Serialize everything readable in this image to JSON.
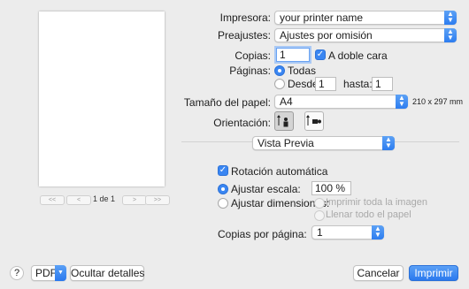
{
  "preview": {
    "page_counter": "1 de 1",
    "nav": {
      "first": "<<",
      "prev": "<",
      "next": ">",
      "last": ">>"
    }
  },
  "printer": {
    "label": "Impresora:",
    "value": "your printer name"
  },
  "presets": {
    "label": "Preajustes:",
    "value": "Ajustes por omisión"
  },
  "copies": {
    "label": "Copias:",
    "value": "1",
    "duplex_label": "A doble cara",
    "duplex_checked": true
  },
  "pages": {
    "label": "Páginas:",
    "all_label": "Todas",
    "from_label": "Desde:",
    "from_value": "1",
    "to_label": "hasta:",
    "to_value": "1",
    "selected": "Todas"
  },
  "paper": {
    "label": "Tamaño del papel:",
    "value": "A4",
    "dimensions": "210 x 297 mm"
  },
  "orientation": {
    "label": "Orientación:",
    "selected": "portrait"
  },
  "section_menu": {
    "value": "Vista Previa"
  },
  "auto_rotate": {
    "label": "Rotación automática",
    "checked": true
  },
  "scale": {
    "label": "Ajustar escala:",
    "value": "100 %",
    "selected": true
  },
  "fit": {
    "label": "Ajustar dimensiones:",
    "print_entire": "Imprimir toda la imagen",
    "fill_paper": "Llenar todo el papel"
  },
  "copies_per_page": {
    "label": "Copias por página:",
    "value": "1"
  },
  "footer": {
    "help": "?",
    "pdf": "PDF",
    "hide_details": "Ocultar detalles",
    "cancel": "Cancelar",
    "print": "Imprimir"
  },
  "colors": {
    "accent": "#3a86f2",
    "background": "#ececec"
  }
}
